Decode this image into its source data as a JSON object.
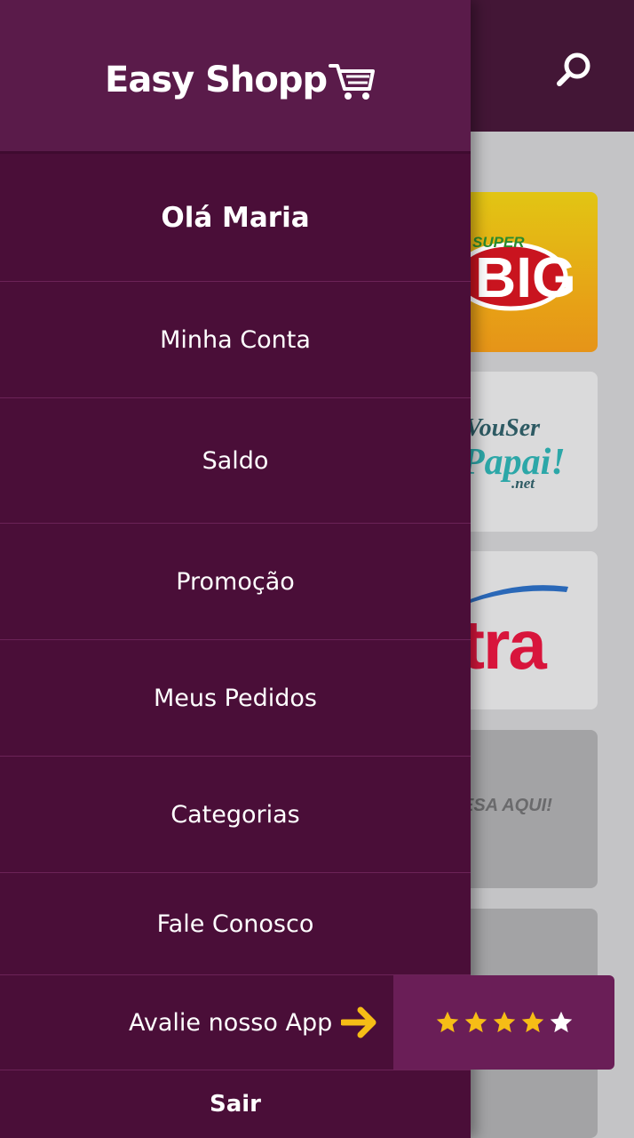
{
  "drawer": {
    "logo_text": "Easy Shopp",
    "greeting": "Olá Maria",
    "items": [
      {
        "label": "Minha Conta"
      },
      {
        "label": "Saldo"
      },
      {
        "label": "Promoção"
      },
      {
        "label": "Meus Pedidos"
      },
      {
        "label": "Categorias"
      },
      {
        "label": "Fale Conosco"
      }
    ],
    "rate_label": "Avalie nosso App",
    "logout_label": "Sair"
  },
  "rating": {
    "stars_filled": 4,
    "stars_total": 5,
    "star_color": "#f6bd16"
  },
  "background": {
    "cards": [
      {
        "text_super": "SUPER",
        "text_main": "BIG"
      },
      {
        "line1": "VouSer",
        "line2": "Papai!",
        "line3": ".net"
      },
      {
        "text": "tra"
      },
      {
        "text": "ESA AQUI!"
      }
    ]
  },
  "colors": {
    "drawer": "#4a0e38",
    "drawer_header": "#5a1b4a",
    "app_header": "#431636",
    "accent": "#f6bd16"
  }
}
